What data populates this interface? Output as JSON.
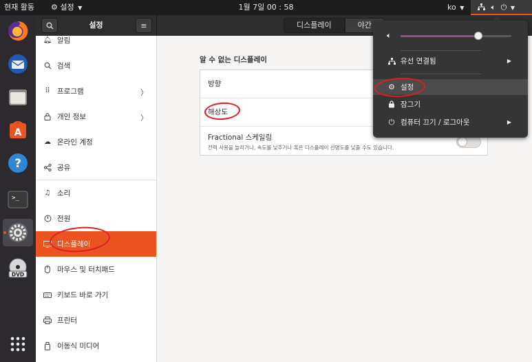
{
  "topbar": {
    "activities": "현재 활동",
    "app_menu": "설정",
    "clock": "1월 7일  00 : 58",
    "language": "ko"
  },
  "dock": {
    "items": [
      "firefox-icon",
      "thunderbird-icon",
      "files-icon",
      "software-icon",
      "help-icon",
      "terminal-icon",
      "settings-icon",
      "dvd-icon",
      "app-grid-icon"
    ],
    "dvd_label": "DVD"
  },
  "header": {
    "title": "설정",
    "tabs": [
      {
        "label": "디스플레이",
        "selected": true
      },
      {
        "label": "야간"
      }
    ]
  },
  "sidebar": {
    "items": [
      {
        "label": "알림",
        "icon": "bell-icon"
      },
      {
        "label": "검색",
        "icon": "search-icon"
      },
      {
        "label": "프로그램",
        "icon": "grid-icon",
        "chevron": "〉"
      },
      {
        "label": "개인 정보",
        "icon": "lock-icon",
        "chevron": "〉"
      },
      {
        "label": "온라인 계정",
        "icon": "cloud-icon"
      },
      {
        "label": "공유",
        "icon": "share-icon"
      },
      {
        "label": "소리",
        "icon": "music-note-icon"
      },
      {
        "label": "전원",
        "icon": "power-icon"
      },
      {
        "label": "디스플레이",
        "icon": "display-icon",
        "selected": true
      },
      {
        "label": "마우스 및 터치패드",
        "icon": "mouse-icon"
      },
      {
        "label": "키보드 바로 가기",
        "icon": "keyboard-icon"
      },
      {
        "label": "프린터",
        "icon": "printer-icon"
      },
      {
        "label": "이동식 미디어",
        "icon": "usb-icon"
      }
    ]
  },
  "panel": {
    "title": "알 수 없는 디스플레이",
    "rows": {
      "orientation": "방향",
      "resolution": "해상도",
      "fractional_title": "Fractional 스케일링",
      "fractional_desc": "전력 사용을 늘리거나, 속도를 낮추거나 혹은 디스플레이 선명도를 낮출 수도 있습니다.",
      "fractional_enabled": false
    }
  },
  "system_menu": {
    "volume_level": 0.7,
    "wired": "유선 연결됨",
    "settings": "설정",
    "lock": "잠그기",
    "power": "컴퓨터 끄기 / 로그아웃"
  },
  "colors": {
    "accent": "#e95420",
    "annotation": "#e01b24",
    "volume": "#924d8b"
  }
}
